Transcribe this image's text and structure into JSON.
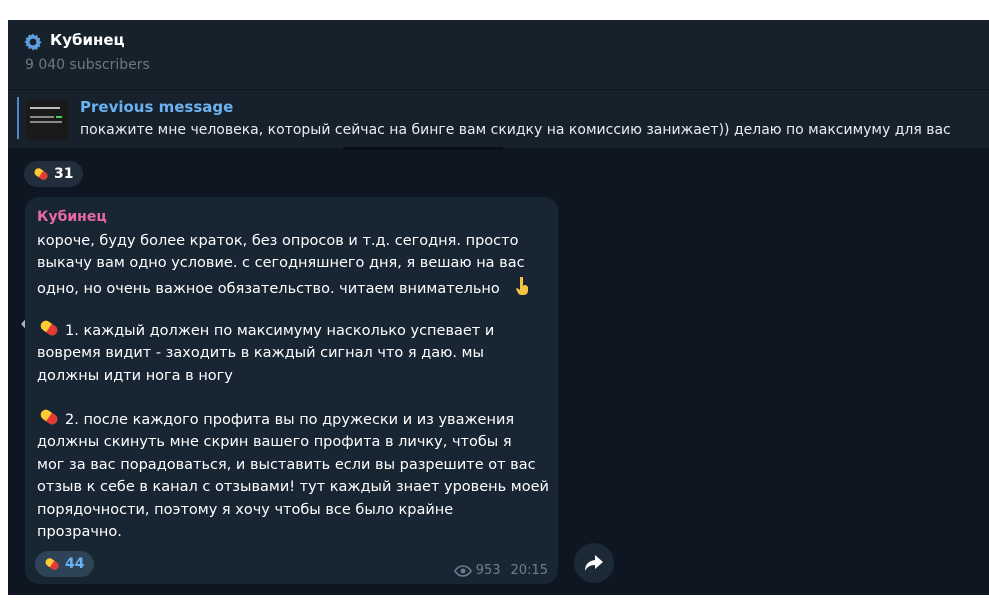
{
  "channel": {
    "name": "Кубинец",
    "subscribers": "9 040 subscribers"
  },
  "pinned": {
    "title": "Previous message",
    "text": "покажите мне человека, который сейчас на бинге вам скидку на комиссию занижает))   делаю по максимуму для вас"
  },
  "reactions": {
    "top_count": "31",
    "bubble_count": "44",
    "emoji": "pill"
  },
  "message": {
    "sender": "Кубинец",
    "p1": [
      "короче, буду более краток, без опросов и т.д. сегодня. просто",
      "выкачу вам одно условие. с сегодняшнего дня, я вешаю на вас",
      "одно, но очень важное обязательство. читаем внимательно"
    ],
    "p2": [
      "1. каждый должен по максимуму  насколько успевает и",
      "вовремя видит - заходить в каждый сигнал что я даю. мы",
      "должны идти нога в ногу"
    ],
    "p3": [
      "2. после каждого профита вы по дружески и из уважения",
      "должны скинуть мне скрин вашего профита в личку, чтобы я",
      "мог за вас порадоваться, и выставить если вы разрешите от вас",
      "отзыв к себе в канал с отзывами! тут каждый знает уровень моей",
      "порядочности, поэтому я хочу чтобы все было крайне",
      "прозрачно."
    ],
    "views": "953",
    "time": "20:15"
  },
  "icons": {
    "channel": "gear-icon",
    "eye": "eye-icon",
    "share": "share-icon",
    "prev": "chevron-left-icon",
    "point_down": "point-down-icon"
  },
  "colors": {
    "background": "#0e1621",
    "header": "#17212b",
    "bubble": "#182533",
    "accent": "#6ab2f2",
    "sender": "#e86aa0"
  }
}
